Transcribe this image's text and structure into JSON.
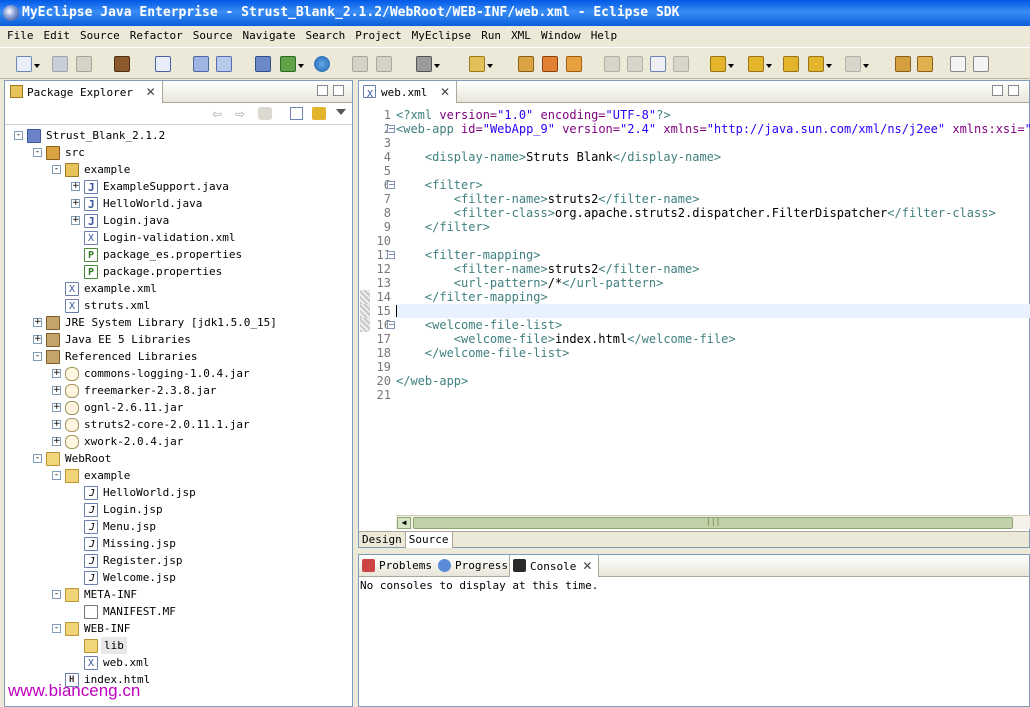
{
  "window": {
    "title": "MyEclipse Java Enterprise - Strust_Blank_2.1.2/WebRoot/WEB-INF/web.xml - Eclipse SDK"
  },
  "menu": [
    "File",
    "Edit",
    "Source",
    "Refactor",
    "Source",
    "Navigate",
    "Search",
    "Project",
    "MyEclipse",
    "Run",
    "XML",
    "Window",
    "Help"
  ],
  "package_explorer": {
    "tab_label": "Package Explorer",
    "tree": [
      {
        "label": "Strust_Blank_2.1.2",
        "depth": 0,
        "icon": "project",
        "exp": "-"
      },
      {
        "label": "src",
        "depth": 1,
        "icon": "src",
        "exp": "-"
      },
      {
        "label": "example",
        "depth": 2,
        "icon": "pkg",
        "exp": "-"
      },
      {
        "label": "ExampleSupport.java",
        "depth": 3,
        "icon": "java",
        "exp": "+"
      },
      {
        "label": "HelloWorld.java",
        "depth": 3,
        "icon": "java",
        "exp": "+"
      },
      {
        "label": "Login.java",
        "depth": 3,
        "icon": "java",
        "exp": "+"
      },
      {
        "label": "Login-validation.xml",
        "depth": 3,
        "icon": "xml",
        "exp": ""
      },
      {
        "label": "package_es.properties",
        "depth": 3,
        "icon": "prop",
        "exp": ""
      },
      {
        "label": "package.properties",
        "depth": 3,
        "icon": "prop",
        "exp": ""
      },
      {
        "label": "example.xml",
        "depth": 2,
        "icon": "xml",
        "exp": ""
      },
      {
        "label": "struts.xml",
        "depth": 2,
        "icon": "xml",
        "exp": ""
      },
      {
        "label": "JRE System Library [jdk1.5.0_15]",
        "depth": 1,
        "icon": "lib",
        "exp": "+"
      },
      {
        "label": "Java EE 5 Libraries",
        "depth": 1,
        "icon": "lib",
        "exp": "+"
      },
      {
        "label": "Referenced Libraries",
        "depth": 1,
        "icon": "lib",
        "exp": "-"
      },
      {
        "label": "commons-logging-1.0.4.jar",
        "depth": 2,
        "icon": "jar",
        "exp": "+"
      },
      {
        "label": "freemarker-2.3.8.jar",
        "depth": 2,
        "icon": "jar",
        "exp": "+"
      },
      {
        "label": "ognl-2.6.11.jar",
        "depth": 2,
        "icon": "jar",
        "exp": "+"
      },
      {
        "label": "struts2-core-2.0.11.1.jar",
        "depth": 2,
        "icon": "jar",
        "exp": "+"
      },
      {
        "label": "xwork-2.0.4.jar",
        "depth": 2,
        "icon": "jar",
        "exp": "+"
      },
      {
        "label": "WebRoot",
        "depth": 1,
        "icon": "folder",
        "exp": "-"
      },
      {
        "label": "example",
        "depth": 2,
        "icon": "folder",
        "exp": "-"
      },
      {
        "label": "HelloWorld.jsp",
        "depth": 3,
        "icon": "jsp",
        "exp": ""
      },
      {
        "label": "Login.jsp",
        "depth": 3,
        "icon": "jsp",
        "exp": ""
      },
      {
        "label": "Menu.jsp",
        "depth": 3,
        "icon": "jsp",
        "exp": ""
      },
      {
        "label": "Missing.jsp",
        "depth": 3,
        "icon": "jsp",
        "exp": ""
      },
      {
        "label": "Register.jsp",
        "depth": 3,
        "icon": "jsp",
        "exp": ""
      },
      {
        "label": "Welcome.jsp",
        "depth": 3,
        "icon": "jsp",
        "exp": ""
      },
      {
        "label": "META-INF",
        "depth": 2,
        "icon": "folder",
        "exp": "-"
      },
      {
        "label": "MANIFEST.MF",
        "depth": 3,
        "icon": "mf",
        "exp": ""
      },
      {
        "label": "WEB-INF",
        "depth": 2,
        "icon": "folder",
        "exp": "-"
      },
      {
        "label": "lib",
        "depth": 3,
        "icon": "folder",
        "exp": ""
      },
      {
        "label": "web.xml",
        "depth": 3,
        "icon": "xml",
        "exp": ""
      },
      {
        "label": "index.html",
        "depth": 2,
        "icon": "html",
        "exp": ""
      }
    ]
  },
  "editor": {
    "tab_label": "web.xml",
    "lines": [
      [
        [
          "t",
          "<?"
        ],
        [
          "t",
          "xml "
        ],
        [
          "a",
          "version="
        ],
        [
          "v",
          "\"1.0\""
        ],
        [
          "a",
          " encoding="
        ],
        [
          "v",
          "\"UTF-8\""
        ],
        [
          "t",
          "?>"
        ]
      ],
      [
        [
          "t",
          "<web-app "
        ],
        [
          "a",
          "id="
        ],
        [
          "v",
          "\"WebApp_9\""
        ],
        [
          "a",
          " version="
        ],
        [
          "v",
          "\"2.4\""
        ],
        [
          "a",
          " xmlns="
        ],
        [
          "v",
          "\"http://java.sun.com/xml/ns/j2ee\""
        ],
        [
          "a",
          " xmlns:xsi="
        ],
        [
          "v",
          "\"http"
        ]
      ],
      [],
      [
        [
          "tx",
          "    "
        ],
        [
          "t",
          "<display-name>"
        ],
        [
          "tx",
          "Struts Blank"
        ],
        [
          "t",
          "</display-name>"
        ]
      ],
      [],
      [
        [
          "tx",
          "    "
        ],
        [
          "t",
          "<filter>"
        ]
      ],
      [
        [
          "tx",
          "        "
        ],
        [
          "t",
          "<filter-name>"
        ],
        [
          "tx",
          "struts2"
        ],
        [
          "t",
          "</filter-name>"
        ]
      ],
      [
        [
          "tx",
          "        "
        ],
        [
          "t",
          "<filter-class>"
        ],
        [
          "tx",
          "org.apache.struts2.dispatcher.FilterDispatcher"
        ],
        [
          "t",
          "</filter-class>"
        ]
      ],
      [
        [
          "tx",
          "    "
        ],
        [
          "t",
          "</filter>"
        ]
      ],
      [],
      [
        [
          "tx",
          "    "
        ],
        [
          "t",
          "<filter-mapping>"
        ]
      ],
      [
        [
          "tx",
          "        "
        ],
        [
          "t",
          "<filter-name>"
        ],
        [
          "tx",
          "struts2"
        ],
        [
          "t",
          "</filter-name>"
        ]
      ],
      [
        [
          "tx",
          "        "
        ],
        [
          "t",
          "<url-pattern>"
        ],
        [
          "tx",
          "/*"
        ],
        [
          "t",
          "</url-pattern>"
        ]
      ],
      [
        [
          "tx",
          "    "
        ],
        [
          "t",
          "</filter-mapping>"
        ]
      ],
      [],
      [
        [
          "tx",
          "    "
        ],
        [
          "t",
          "<welcome-file-list>"
        ]
      ],
      [
        [
          "tx",
          "        "
        ],
        [
          "t",
          "<welcome-file>"
        ],
        [
          "tx",
          "index.html"
        ],
        [
          "t",
          "</welcome-file>"
        ]
      ],
      [
        [
          "tx",
          "    "
        ],
        [
          "t",
          "</welcome-file-list>"
        ]
      ],
      [],
      [
        [
          "t",
          "</web-app>"
        ]
      ],
      []
    ],
    "fold_lines": [
      2,
      6,
      11,
      16
    ],
    "current_line": 15,
    "bottom_tabs": [
      "Design",
      "Source"
    ],
    "active_bottom_tab": "Source",
    "hscroll_grip": "|||"
  },
  "console_panel": {
    "tabs": [
      "Problems",
      "Progress",
      "Console"
    ],
    "active_tab": "Console",
    "message": "No consoles to display at this time."
  },
  "watermark": "www.bianceng.cn"
}
